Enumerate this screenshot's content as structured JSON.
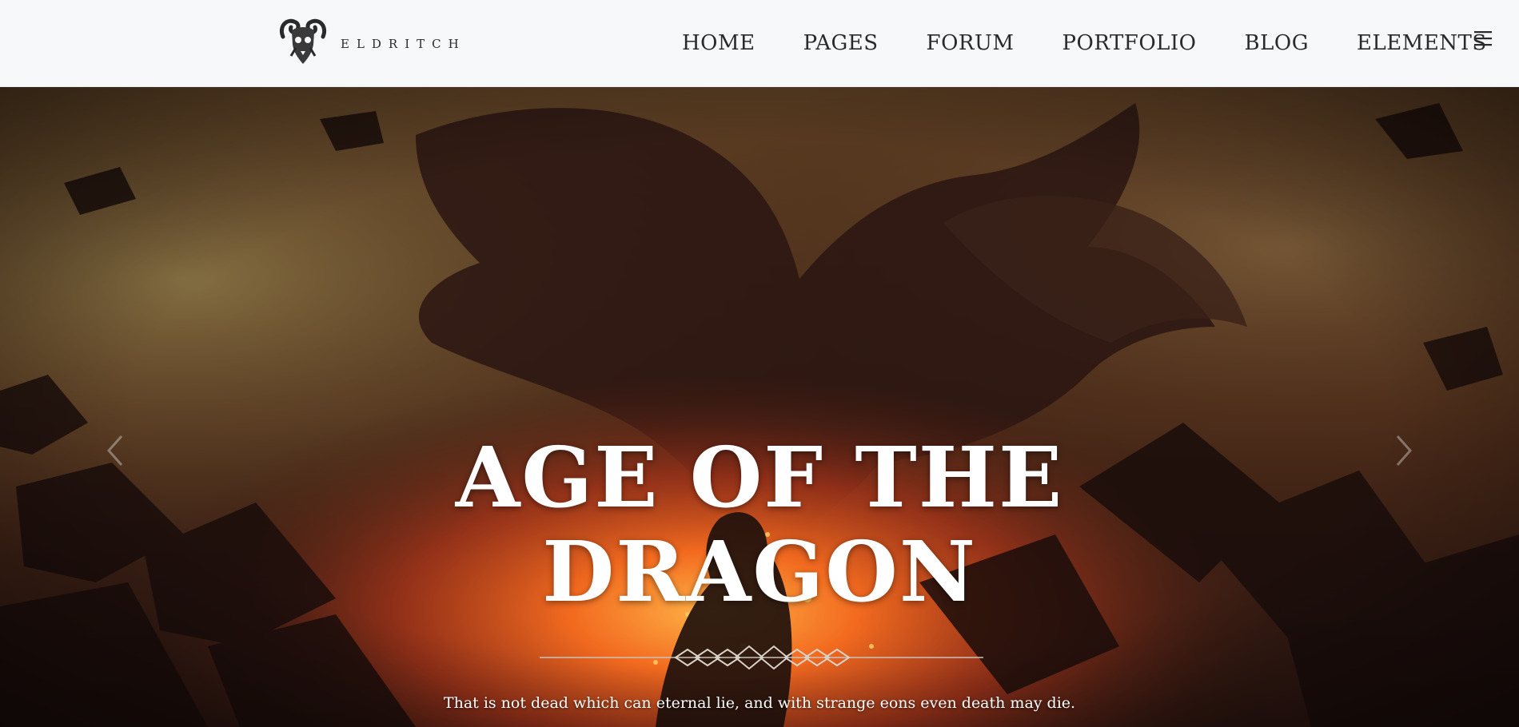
{
  "site": {
    "logo_text": "ELDRITCH",
    "logo_icon": "ram-skull-icon"
  },
  "nav": {
    "items": [
      {
        "label": "HOME"
      },
      {
        "label": "PAGES"
      },
      {
        "label": "FORUM"
      },
      {
        "label": "PORTFOLIO"
      },
      {
        "label": "BLOG"
      },
      {
        "label": "ELEMENTS"
      }
    ],
    "menu_icon": "hamburger-menu-icon"
  },
  "hero": {
    "title_line1": "AGE OF THE",
    "title_line2": "DRAGON",
    "quote": "That is not dead which can eternal lie, and with strange eons even death may die.",
    "divider_icon": "celtic-knot-divider-icon",
    "prev_icon": "chevron-left-icon",
    "next_icon": "chevron-right-icon"
  },
  "colors": {
    "header_bg": "#f6f8fa",
    "nav_text": "#2a2a2a",
    "hero_text": "#ffffff",
    "fire": "#e8541c"
  }
}
